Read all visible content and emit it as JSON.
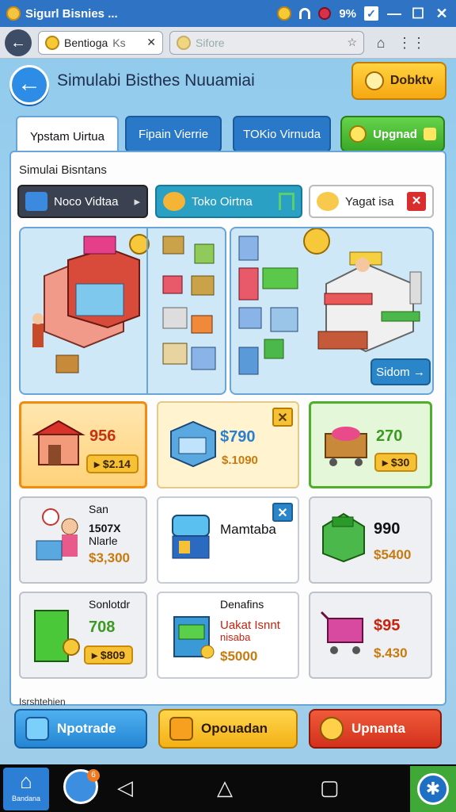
{
  "statusbar": {
    "title": "Sigurl Bisnies ...",
    "battery": "9%",
    "checkbox": "✓",
    "minimize": "—",
    "maximize": "☐",
    "close": "✕"
  },
  "browser": {
    "back": "←",
    "tab1_label": "Bentioga",
    "tab1_extra": "Ks",
    "tab1_close": "✕",
    "tab2_label": "Sifore",
    "tab2_star": "☆",
    "home_icon": "⌂",
    "menu_icon": "⋮⋮"
  },
  "header": {
    "back": "←",
    "title": "Simulabi Bisthes Nuuamiai",
    "action_label": "Dobktv"
  },
  "main_tabs": [
    {
      "label": "Ypstam Uirtua"
    },
    {
      "label": "Fipain Vierrie"
    },
    {
      "label": "TOKio Virnuda"
    }
  ],
  "upgrade_tab": {
    "label": "Upgnad"
  },
  "section": {
    "title": "Simulai Bisntans"
  },
  "segments": {
    "dark_label": "Noco Vidtaa",
    "dark_arrow": "▸",
    "teal_label": "Toko Oirtna",
    "white_label": "Yagat isa",
    "white_close": "✕"
  },
  "scene": {
    "button_label": "Sidom →"
  },
  "cards": [
    {
      "price": "956",
      "pill": "▸ $2.14"
    },
    {
      "price": "$790",
      "sub": "$.1090",
      "corner": "✕"
    },
    {
      "price": "270",
      "pill": "▸ $30"
    },
    {
      "lbl1": "San",
      "lbl2": "1507X",
      "lbl3": "Nlarle",
      "price": "$3,300"
    },
    {
      "lbl1": "Mamtaba",
      "corner": "✕"
    },
    {
      "price": "990",
      "sub": "$5400"
    },
    {
      "lbl1": "Sonlotdr",
      "price": "708",
      "pill": "▸ $809"
    },
    {
      "lbl1": "Denafins",
      "lbl2": "Uakat Isnnt",
      "lbl3": "nisaba",
      "price": "$5000"
    },
    {
      "price": "$95",
      "sub": "$.430"
    }
  ],
  "bottom_hint": "Isrshtehien",
  "bottom_buttons": [
    {
      "label": "Npotrade"
    },
    {
      "label": "Opouadan"
    },
    {
      "label": "Upnanta"
    }
  ],
  "navbar": {
    "home_label": "Bandana",
    "home_icon": "⌂",
    "chat_badge": "6",
    "back_icon": "◁",
    "home_nav_icon": "△",
    "recent_icon": "▢",
    "gear_icon": "✱"
  },
  "colors": {
    "accent": "#2f73c4",
    "orange": "#f08c12",
    "green": "#4fae2e"
  }
}
